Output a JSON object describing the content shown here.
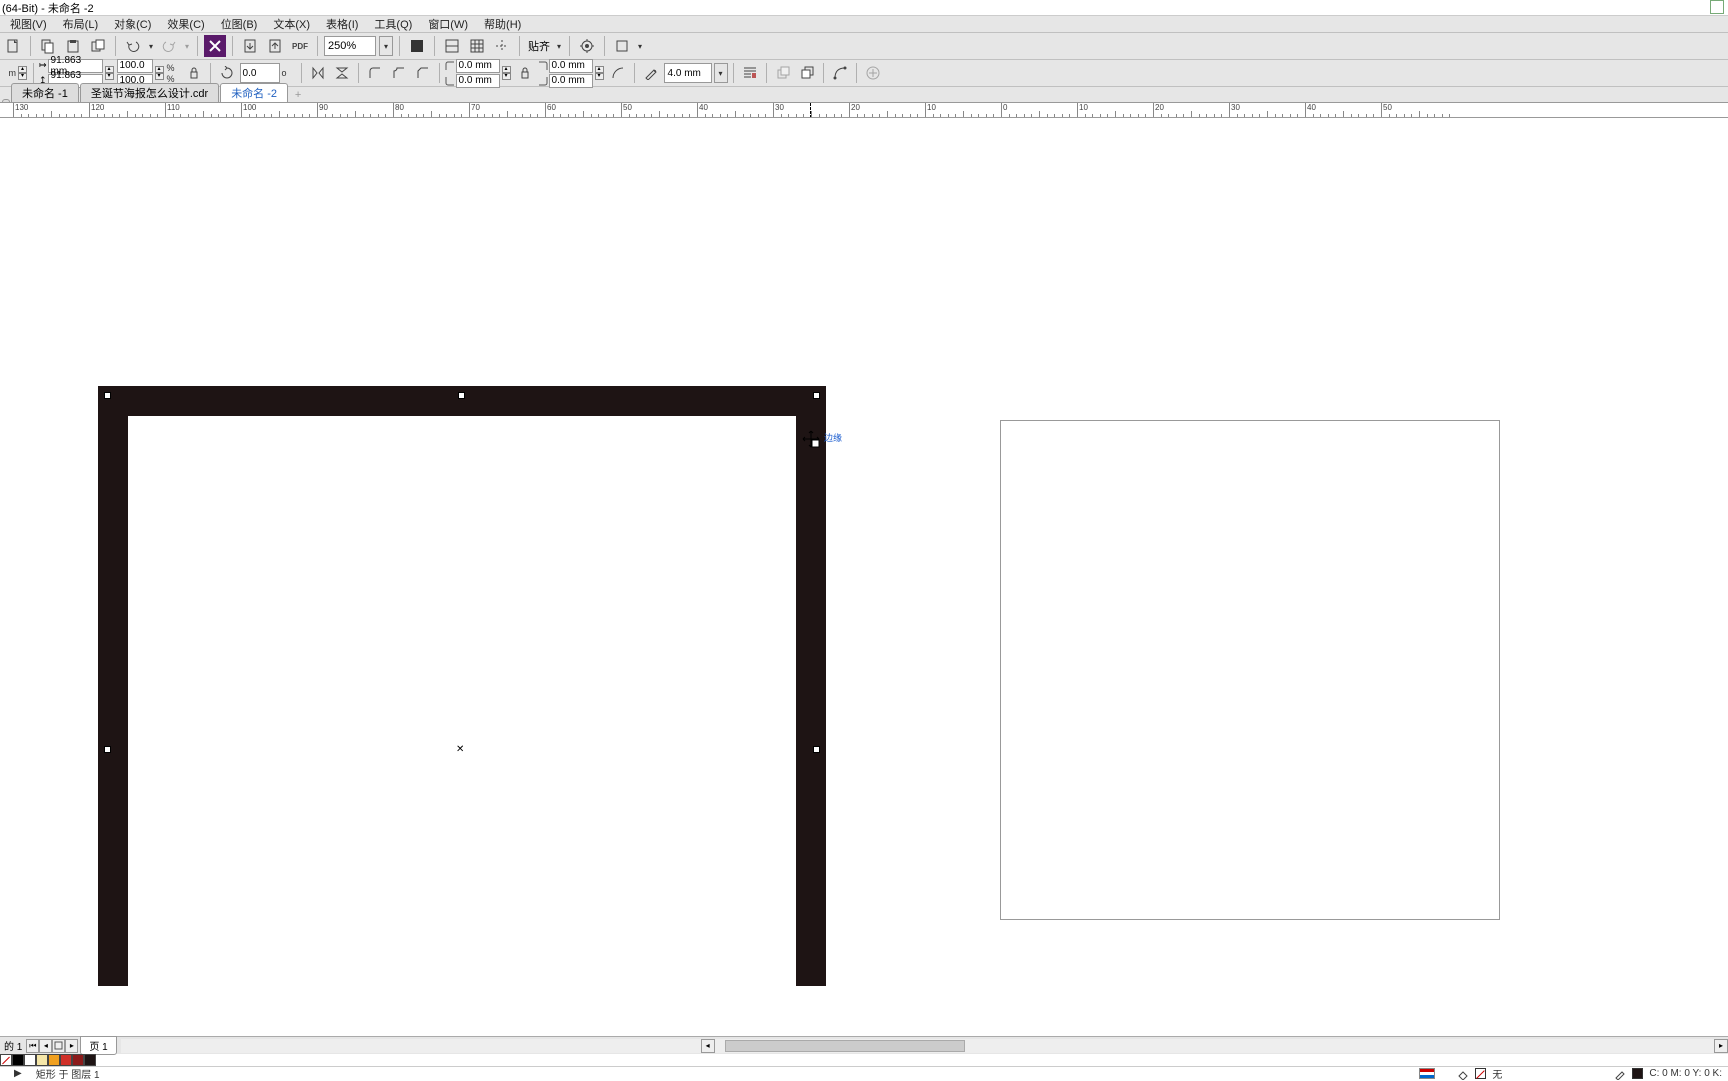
{
  "title": "(64-Bit) - 未命名 -2",
  "menu": {
    "view": "视图(V)",
    "layout": "布局(L)",
    "object": "对象(C)",
    "effect": "效果(C)",
    "bitmap": "位图(B)",
    "text": "文本(X)",
    "table": "表格(I)",
    "tools": "工具(Q)",
    "window": "窗口(W)",
    "help": "帮助(H)"
  },
  "toolbar1": {
    "zoom": "250%",
    "snap": "贴齐"
  },
  "toolbar2": {
    "pos_suffix": "m",
    "width": "91.863 mm",
    "height": "91.863 mm",
    "scale_x": "100.0",
    "scale_y": "100.0",
    "pct": "%",
    "angle": "0.0",
    "deg": "o",
    "corner1": "0.0 mm",
    "corner2": "0.0 mm",
    "corner3": "0.0 mm",
    "corner4": "0.0 mm",
    "outline": "4.0 mm"
  },
  "tabs": {
    "t1": "未命名 -1",
    "t2": "圣诞节海报怎么设计.cdr",
    "t3": "未命名 -2"
  },
  "ruler_marks": [
    "130",
    "120",
    "110",
    "100",
    "90",
    "80",
    "70",
    "60",
    "50",
    "40",
    "30",
    "20",
    "10",
    "0",
    "10",
    "20",
    "30",
    "40",
    "50"
  ],
  "cursor_hint": "边缘",
  "page_nav": {
    "label": "的 1",
    "page": "页 1"
  },
  "status": {
    "object": "矩形 于 图层 1",
    "arrow": "▶",
    "none_label": "无",
    "fill_info": "C: 0 M: 0 Y: 0 K:"
  },
  "swatches": [
    "transparent",
    "#000000",
    "#ffffff",
    "#f5e6a8",
    "#f0a020",
    "#d03028",
    "#8b1a1a",
    "#1e1414"
  ]
}
